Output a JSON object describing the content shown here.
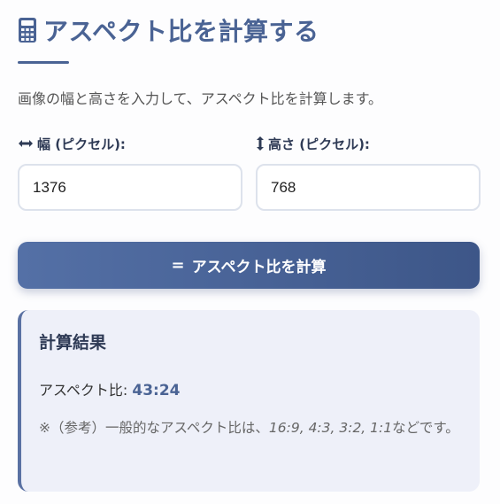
{
  "header": {
    "title": "アスペクト比を計算する",
    "description": "画像の幅と高さを入力して、アスペクト比を計算します。"
  },
  "width_field": {
    "label": "幅 (ピクセル):",
    "value": "1376"
  },
  "height_field": {
    "label": "高さ (ピクセル):",
    "value": "768"
  },
  "calculate_button": {
    "label": "アスペクト比を計算"
  },
  "result": {
    "title": "計算結果",
    "ratio_label": "アスペクト比:",
    "ratio_value": "43:24",
    "note_prefix": "※（参考）一般的なアスペクト比は、",
    "note_ratios": "16:9, 4:3, 3:2, 1:1",
    "note_suffix": "などです。"
  },
  "colors": {
    "accent": "#4a6394",
    "button_start": "#5470a6",
    "button_end": "#3d5688",
    "result_bg": "#eef0f9"
  }
}
